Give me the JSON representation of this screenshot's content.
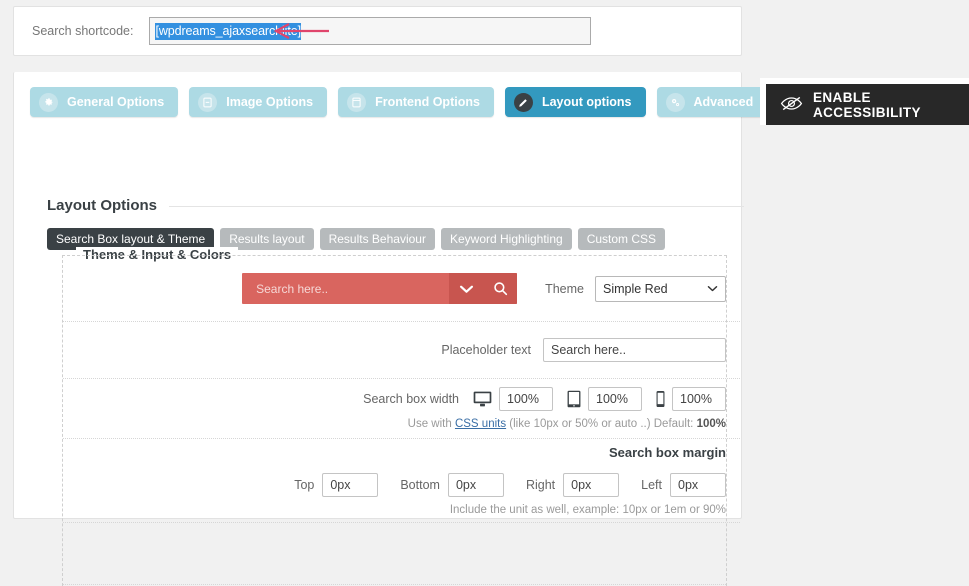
{
  "shortcode": {
    "label": "Search shortcode:",
    "value": "[wpdreams_ajaxsearchlite]",
    "arrow_color": "#e0456c",
    "selection_color": "#3390e0"
  },
  "tabs": [
    {
      "label": "General Options",
      "icon": "gear-icon",
      "active": false
    },
    {
      "label": "Image Options",
      "icon": "image-icon",
      "active": false
    },
    {
      "label": "Frontend Options",
      "icon": "browser-icon",
      "active": false
    },
    {
      "label": "Layout options",
      "icon": "pencil-icon",
      "active": true
    },
    {
      "label": "Advanced",
      "icon": "cogs-icon",
      "active": false
    }
  ],
  "group": {
    "title": "Layout Options",
    "subtabs": [
      {
        "label": "Search Box layout & Theme",
        "active": true
      },
      {
        "label": "Results layout",
        "active": false
      },
      {
        "label": "Results Behaviour",
        "active": false
      },
      {
        "label": "Keyword Highlighting",
        "active": false
      },
      {
        "label": "Custom CSS",
        "active": false
      }
    ]
  },
  "fieldset": {
    "legend": "Theme & Input & Colors",
    "preview": {
      "placeholder": "Search here..",
      "bar_color": "#d9655f",
      "button_color": "#c8554f",
      "settings_icon": "chevron-down-icon",
      "search_icon": "magnifier-icon"
    },
    "theme": {
      "label": "Theme",
      "selected": "Simple Red",
      "options": [
        "Simple Red"
      ]
    },
    "placeholder_row": {
      "label": "Placeholder text",
      "value": "Search here.."
    },
    "width_row": {
      "label": "Search box width",
      "devices": [
        {
          "icon": "desktop-icon",
          "value": "100%"
        },
        {
          "icon": "tablet-icon",
          "value": "100%"
        },
        {
          "icon": "mobile-icon",
          "value": "100%"
        }
      ],
      "hint_pre": "Use with ",
      "hint_link": "CSS units",
      "hint_mid": " (like 10px or 50% or auto ..) Default: ",
      "hint_default": "100%"
    },
    "margin_row": {
      "title": "Search box margin",
      "fields": [
        {
          "label": "Top",
          "value": "0px"
        },
        {
          "label": "Bottom",
          "value": "0px"
        },
        {
          "label": "Right",
          "value": "0px"
        },
        {
          "label": "Left",
          "value": "0px"
        }
      ],
      "hint": "Include the unit as well, example: 10px or 1em or 90%"
    }
  },
  "accessibility": {
    "label": "ENABLE ACCESSIBILITY",
    "icon": "eye-slash-icon",
    "background": "#282828"
  }
}
